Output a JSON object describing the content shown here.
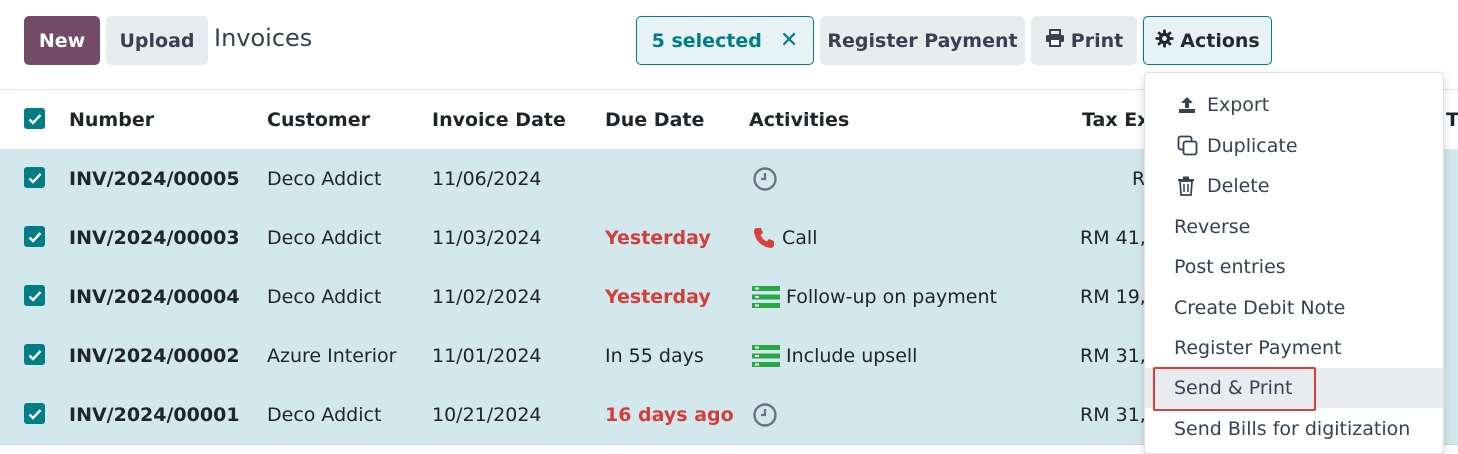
{
  "toolbar": {
    "new_label": "New",
    "upload_label": "Upload",
    "page_title": "Invoices",
    "selected_label": "5 selected",
    "clear_selection_symbol": "✕",
    "register_payment_label": "Register Payment",
    "print_label": "Print",
    "actions_label": "Actions"
  },
  "table": {
    "headers": [
      "Number",
      "Customer",
      "Invoice Date",
      "Due Date",
      "Activities",
      "Tax Ex",
      "T"
    ],
    "rows": [
      {
        "number": "INV/2024/00005",
        "customer": "Deco Addict",
        "invoice_date": "11/06/2024",
        "due_date": "",
        "due_status": "normal",
        "activity_icon": "clock-icon",
        "activity": "",
        "tax": "R"
      },
      {
        "number": "INV/2024/00003",
        "customer": "Deco Addict",
        "invoice_date": "11/03/2024",
        "due_date": "Yesterday",
        "due_status": "overdue",
        "activity_icon": "phone-icon",
        "activity": "Call",
        "tax": "RM 41,"
      },
      {
        "number": "INV/2024/00004",
        "customer": "Deco Addict",
        "invoice_date": "11/02/2024",
        "due_date": "Yesterday",
        "due_status": "overdue",
        "activity_icon": "todo-list-icon",
        "activity": "Follow-up on payment",
        "tax": "RM 19,"
      },
      {
        "number": "INV/2024/00002",
        "customer": "Azure Interior",
        "invoice_date": "11/01/2024",
        "due_date": "In 55 days",
        "due_status": "normal",
        "activity_icon": "todo-list-icon",
        "activity": "Include upsell",
        "tax": "RM 31,"
      },
      {
        "number": "INV/2024/00001",
        "customer": "Deco Addict",
        "invoice_date": "10/21/2024",
        "due_date": "16 days ago",
        "due_status": "overdue",
        "activity_icon": "clock-icon",
        "activity": "",
        "tax": "RM 31,"
      }
    ]
  },
  "actions_menu": {
    "items": [
      {
        "label": "Export",
        "icon": "upload-icon"
      },
      {
        "label": "Duplicate",
        "icon": "copy-icon"
      },
      {
        "label": "Delete",
        "icon": "trash-icon"
      },
      {
        "label": "Reverse"
      },
      {
        "label": "Post entries"
      },
      {
        "label": "Create Debit Note"
      },
      {
        "label": "Register Payment"
      },
      {
        "label": "Send & Print",
        "highlighted": true
      },
      {
        "label": "Send Bills for digitization"
      }
    ]
  },
  "colors": {
    "brand_primary": "#714b67",
    "accent_teal": "#017e84",
    "selected_row": "#d2e8ed",
    "overdue_red": "#d23f3a",
    "highlight_box": "#e23a3a"
  }
}
